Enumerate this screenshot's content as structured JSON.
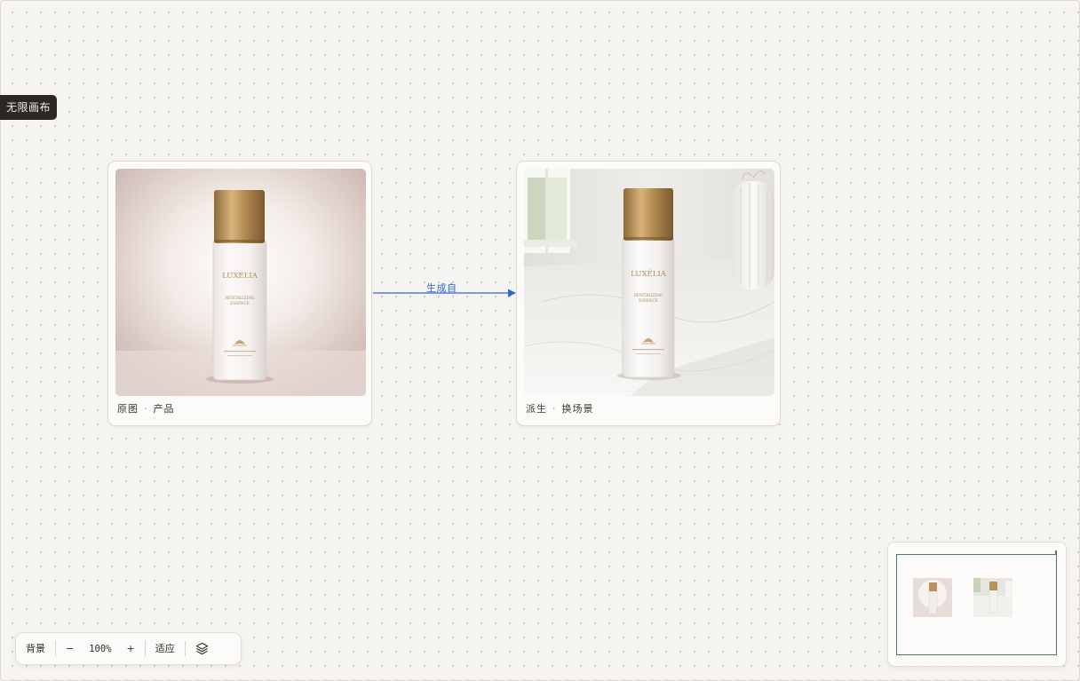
{
  "canvas": {
    "tag": "无限画布"
  },
  "nodes": [
    {
      "type": "原图",
      "label": "产品",
      "bottle_brand": "LUXÉLIA",
      "bottle_line1": "REVITALIZING",
      "bottle_line2": "ESSENCE"
    },
    {
      "type": "派生",
      "label": "换场景",
      "bottle_brand": "LUXÉLIA",
      "bottle_line1": "REVITALIZING",
      "bottle_line2": "ESSENCE"
    }
  ],
  "edge": {
    "label": "生成自",
    "color": "#2f66d6"
  },
  "toolbar": {
    "background": "背景",
    "zoom_out": "−",
    "zoom": "100%",
    "zoom_in": "+",
    "fit": "适应",
    "layers_icon": "layers-icon"
  },
  "colors": {
    "accent": "#2f66d6",
    "tag_bg": "#2b2823",
    "minimap_viewport": "#4d7a66",
    "gold_cap": "#b8925a"
  }
}
